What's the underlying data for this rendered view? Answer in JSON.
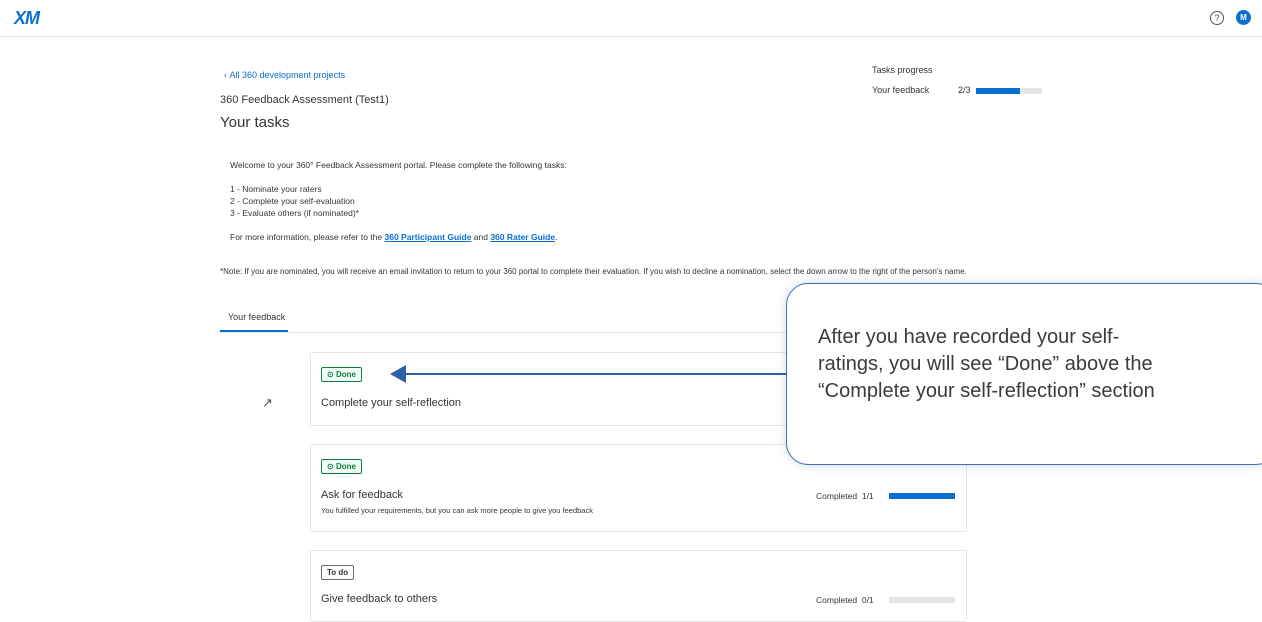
{
  "header": {
    "logo": "XM",
    "help_icon": "?",
    "avatar_initial": "M"
  },
  "breadcrumb": {
    "back_label": "All 360 development projects"
  },
  "project_name": "360 Feedback Assessment (Test1)",
  "page_title": "Your tasks",
  "tasks_progress": {
    "title": "Tasks progress",
    "label": "Your feedback",
    "count": "2/3",
    "fraction": 0.667
  },
  "intro": {
    "welcome": "Welcome to your 360° Feedback Assessment portal. Please complete the following tasks:",
    "item1": "1 - Nominate your raters",
    "item2": "2 - Complete your self-evaluation",
    "item3": "3 - Evaluate others (if nominated)*",
    "info_prefix": "For more information, please refer to the ",
    "participant_guide": "360 Participant Guide",
    "info_and": " and ",
    "rater_guide": "360 Rater Guide",
    "info_suffix": ".",
    "note": "*Note: If you are nominated, you will receive an email invitation to return to your 360 portal to complete their evaluation. If you wish to decline a nomination, select the down arrow to the right of the person's name."
  },
  "tabs": [
    {
      "label": "Your feedback"
    }
  ],
  "cards": [
    {
      "status": "Done",
      "title": "Complete your self-reflection"
    },
    {
      "status": "Done",
      "title": "Ask for feedback",
      "subtitle": "You fulfilled your requirements, but you can ask more people to give you feedback",
      "completed_label": "Completed",
      "count": "1/1",
      "fraction": 1.0
    },
    {
      "status": "To do",
      "title": "Give feedback to others",
      "completed_label": "Completed",
      "count": "0/1",
      "fraction": 0.0
    }
  ],
  "callout": {
    "text": "After you have recorded your self-\nratings, you will see “Done” above the\n“Complete your self-reflection” section"
  },
  "colors": {
    "accent": "#0b6fd2",
    "done_green": "#107e3e",
    "callout_border": "#3f6fae"
  }
}
